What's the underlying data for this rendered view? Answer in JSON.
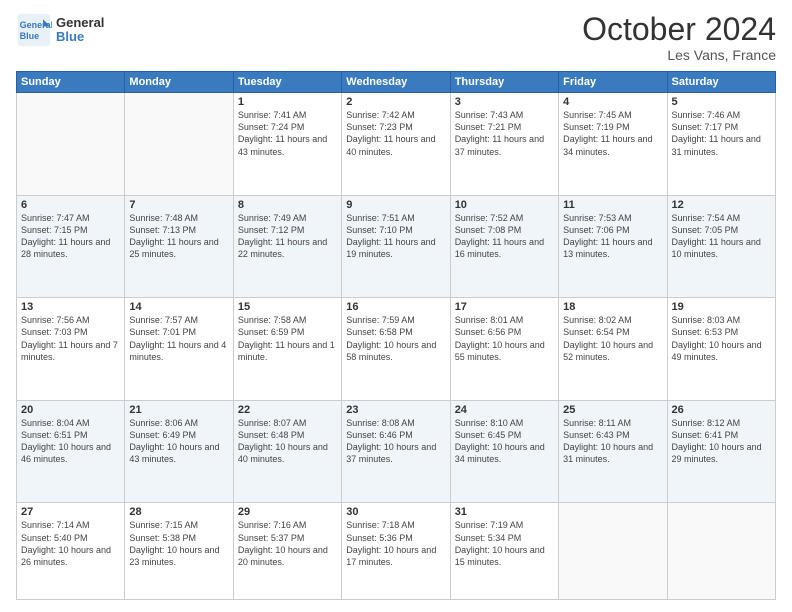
{
  "header": {
    "logo_line1": "General",
    "logo_line2": "Blue",
    "month": "October 2024",
    "location": "Les Vans, France"
  },
  "weekdays": [
    "Sunday",
    "Monday",
    "Tuesday",
    "Wednesday",
    "Thursday",
    "Friday",
    "Saturday"
  ],
  "weeks": [
    [
      {
        "day": "",
        "info": ""
      },
      {
        "day": "",
        "info": ""
      },
      {
        "day": "1",
        "info": "Sunrise: 7:41 AM\nSunset: 7:24 PM\nDaylight: 11 hours and 43 minutes."
      },
      {
        "day": "2",
        "info": "Sunrise: 7:42 AM\nSunset: 7:23 PM\nDaylight: 11 hours and 40 minutes."
      },
      {
        "day": "3",
        "info": "Sunrise: 7:43 AM\nSunset: 7:21 PM\nDaylight: 11 hours and 37 minutes."
      },
      {
        "day": "4",
        "info": "Sunrise: 7:45 AM\nSunset: 7:19 PM\nDaylight: 11 hours and 34 minutes."
      },
      {
        "day": "5",
        "info": "Sunrise: 7:46 AM\nSunset: 7:17 PM\nDaylight: 11 hours and 31 minutes."
      }
    ],
    [
      {
        "day": "6",
        "info": "Sunrise: 7:47 AM\nSunset: 7:15 PM\nDaylight: 11 hours and 28 minutes."
      },
      {
        "day": "7",
        "info": "Sunrise: 7:48 AM\nSunset: 7:13 PM\nDaylight: 11 hours and 25 minutes."
      },
      {
        "day": "8",
        "info": "Sunrise: 7:49 AM\nSunset: 7:12 PM\nDaylight: 11 hours and 22 minutes."
      },
      {
        "day": "9",
        "info": "Sunrise: 7:51 AM\nSunset: 7:10 PM\nDaylight: 11 hours and 19 minutes."
      },
      {
        "day": "10",
        "info": "Sunrise: 7:52 AM\nSunset: 7:08 PM\nDaylight: 11 hours and 16 minutes."
      },
      {
        "day": "11",
        "info": "Sunrise: 7:53 AM\nSunset: 7:06 PM\nDaylight: 11 hours and 13 minutes."
      },
      {
        "day": "12",
        "info": "Sunrise: 7:54 AM\nSunset: 7:05 PM\nDaylight: 11 hours and 10 minutes."
      }
    ],
    [
      {
        "day": "13",
        "info": "Sunrise: 7:56 AM\nSunset: 7:03 PM\nDaylight: 11 hours and 7 minutes."
      },
      {
        "day": "14",
        "info": "Sunrise: 7:57 AM\nSunset: 7:01 PM\nDaylight: 11 hours and 4 minutes."
      },
      {
        "day": "15",
        "info": "Sunrise: 7:58 AM\nSunset: 6:59 PM\nDaylight: 11 hours and 1 minute."
      },
      {
        "day": "16",
        "info": "Sunrise: 7:59 AM\nSunset: 6:58 PM\nDaylight: 10 hours and 58 minutes."
      },
      {
        "day": "17",
        "info": "Sunrise: 8:01 AM\nSunset: 6:56 PM\nDaylight: 10 hours and 55 minutes."
      },
      {
        "day": "18",
        "info": "Sunrise: 8:02 AM\nSunset: 6:54 PM\nDaylight: 10 hours and 52 minutes."
      },
      {
        "day": "19",
        "info": "Sunrise: 8:03 AM\nSunset: 6:53 PM\nDaylight: 10 hours and 49 minutes."
      }
    ],
    [
      {
        "day": "20",
        "info": "Sunrise: 8:04 AM\nSunset: 6:51 PM\nDaylight: 10 hours and 46 minutes."
      },
      {
        "day": "21",
        "info": "Sunrise: 8:06 AM\nSunset: 6:49 PM\nDaylight: 10 hours and 43 minutes."
      },
      {
        "day": "22",
        "info": "Sunrise: 8:07 AM\nSunset: 6:48 PM\nDaylight: 10 hours and 40 minutes."
      },
      {
        "day": "23",
        "info": "Sunrise: 8:08 AM\nSunset: 6:46 PM\nDaylight: 10 hours and 37 minutes."
      },
      {
        "day": "24",
        "info": "Sunrise: 8:10 AM\nSunset: 6:45 PM\nDaylight: 10 hours and 34 minutes."
      },
      {
        "day": "25",
        "info": "Sunrise: 8:11 AM\nSunset: 6:43 PM\nDaylight: 10 hours and 31 minutes."
      },
      {
        "day": "26",
        "info": "Sunrise: 8:12 AM\nSunset: 6:41 PM\nDaylight: 10 hours and 29 minutes."
      }
    ],
    [
      {
        "day": "27",
        "info": "Sunrise: 7:14 AM\nSunset: 5:40 PM\nDaylight: 10 hours and 26 minutes."
      },
      {
        "day": "28",
        "info": "Sunrise: 7:15 AM\nSunset: 5:38 PM\nDaylight: 10 hours and 23 minutes."
      },
      {
        "day": "29",
        "info": "Sunrise: 7:16 AM\nSunset: 5:37 PM\nDaylight: 10 hours and 20 minutes."
      },
      {
        "day": "30",
        "info": "Sunrise: 7:18 AM\nSunset: 5:36 PM\nDaylight: 10 hours and 17 minutes."
      },
      {
        "day": "31",
        "info": "Sunrise: 7:19 AM\nSunset: 5:34 PM\nDaylight: 10 hours and 15 minutes."
      },
      {
        "day": "",
        "info": ""
      },
      {
        "day": "",
        "info": ""
      }
    ]
  ]
}
